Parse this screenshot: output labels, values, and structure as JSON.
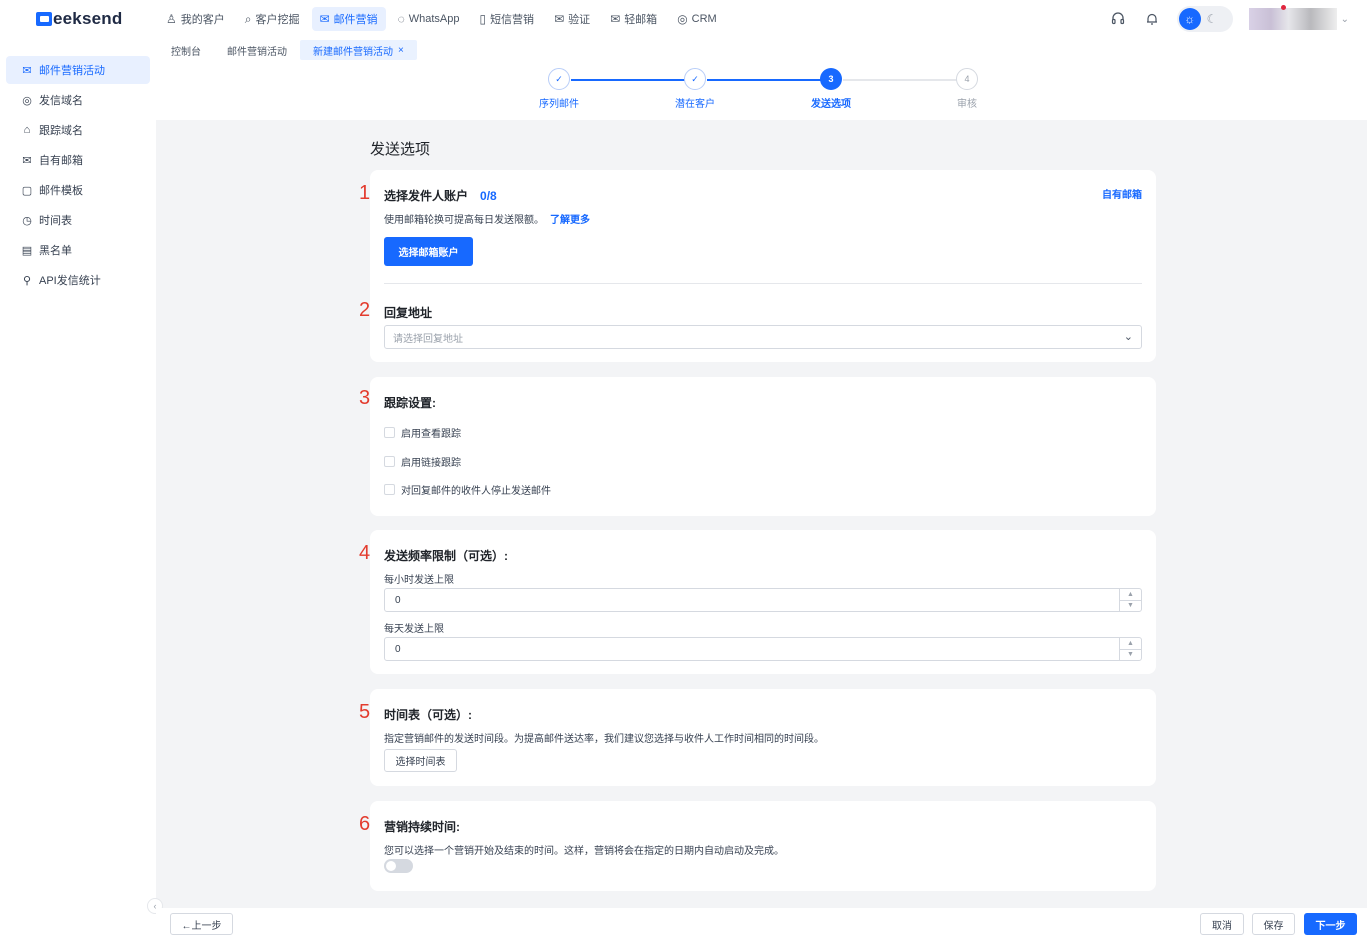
{
  "brand": {
    "logo_text": "eeksend",
    "logo_letter": "G"
  },
  "topnav": [
    {
      "icon": "user-icon",
      "glyph": "♙",
      "label": "我的客户"
    },
    {
      "icon": "search-icon",
      "glyph": "⌕",
      "label": "客户挖掘"
    },
    {
      "icon": "mail-icon",
      "glyph": "✉",
      "label": "邮件营销"
    },
    {
      "icon": "whatsapp-icon",
      "glyph": "◌",
      "label": "WhatsApp"
    },
    {
      "icon": "sms-icon",
      "glyph": "▯",
      "label": "短信营销"
    },
    {
      "icon": "verify-icon",
      "glyph": "✉",
      "label": "验证"
    },
    {
      "icon": "light-mail-icon",
      "glyph": "✉",
      "label": "轻邮箱"
    },
    {
      "icon": "crm-icon",
      "glyph": "◎",
      "label": "CRM"
    }
  ],
  "tabs": [
    {
      "label": "控制台"
    },
    {
      "label": "邮件营销活动"
    },
    {
      "label": "新建邮件营销活动",
      "close": "×"
    }
  ],
  "sidebar": [
    {
      "icon": "campaign-icon",
      "glyph": "✉",
      "label": "邮件营销活动"
    },
    {
      "icon": "domain-icon",
      "glyph": "◎",
      "label": "发信域名"
    },
    {
      "icon": "tracking-icon",
      "glyph": "⌂",
      "label": "跟踪域名"
    },
    {
      "icon": "own-mailbox-icon",
      "glyph": "✉",
      "label": "自有邮箱"
    },
    {
      "icon": "template-icon",
      "glyph": "▢",
      "label": "邮件模板"
    },
    {
      "icon": "schedule-icon",
      "glyph": "◷",
      "label": "时间表"
    },
    {
      "icon": "blacklist-icon",
      "glyph": "▤",
      "label": "黑名单"
    },
    {
      "icon": "api-icon",
      "glyph": "⚲",
      "label": "API发信统计"
    }
  ],
  "steps": [
    {
      "label": "序列邮件",
      "mark": "✓",
      "state": "done"
    },
    {
      "label": "潜在客户",
      "mark": "✓",
      "state": "done"
    },
    {
      "label": "发送选项",
      "mark": "3",
      "state": "current"
    },
    {
      "label": "审核",
      "mark": "4",
      "state": "todo"
    }
  ],
  "page_title": "发送选项",
  "sections": {
    "sender": {
      "num": "1",
      "title": "选择发件人账户",
      "count": "0/8",
      "desc": "使用邮箱轮换可提高每日发送限额。",
      "learn_more": "了解更多",
      "own_mailbox_link": "自有邮箱",
      "button": "选择邮箱账户"
    },
    "reply": {
      "num": "2",
      "title": "回复地址",
      "placeholder": "请选择回复地址",
      "chevron": "⌄"
    },
    "tracking": {
      "num": "3",
      "title": "跟踪设置:",
      "options": [
        {
          "label": "启用查看跟踪",
          "checked": false
        },
        {
          "label": "启用链接跟踪",
          "checked": false
        },
        {
          "label": "对回复邮件的收件人停止发送邮件",
          "checked": false
        }
      ]
    },
    "rate": {
      "num": "4",
      "title": "发送频率限制（可选）:",
      "hourly_label": "每小时发送上限",
      "hourly_value": "0",
      "daily_label": "每天发送上限",
      "daily_value": "0",
      "spin_up": "▲",
      "spin_down": "▼"
    },
    "schedule": {
      "num": "5",
      "title": "时间表（可选）:",
      "desc": "指定营销邮件的发送时间段。为提高邮件送达率，我们建议您选择与收件人工作时间相同的时间段。",
      "button": "选择时间表"
    },
    "duration": {
      "num": "6",
      "title": "营销持续时间:",
      "desc": "您可以选择一个营销开始及结束的时间。这样，营销将会在指定的日期内自动启动及完成。",
      "enabled": false
    }
  },
  "footer": {
    "prev": "←上一步",
    "cancel": "取消",
    "save": "保存",
    "next": "下一步"
  },
  "colors": {
    "accent": "#1769ff",
    "number_red": "#e33b2e",
    "bg_gray": "#f3f4f6"
  }
}
